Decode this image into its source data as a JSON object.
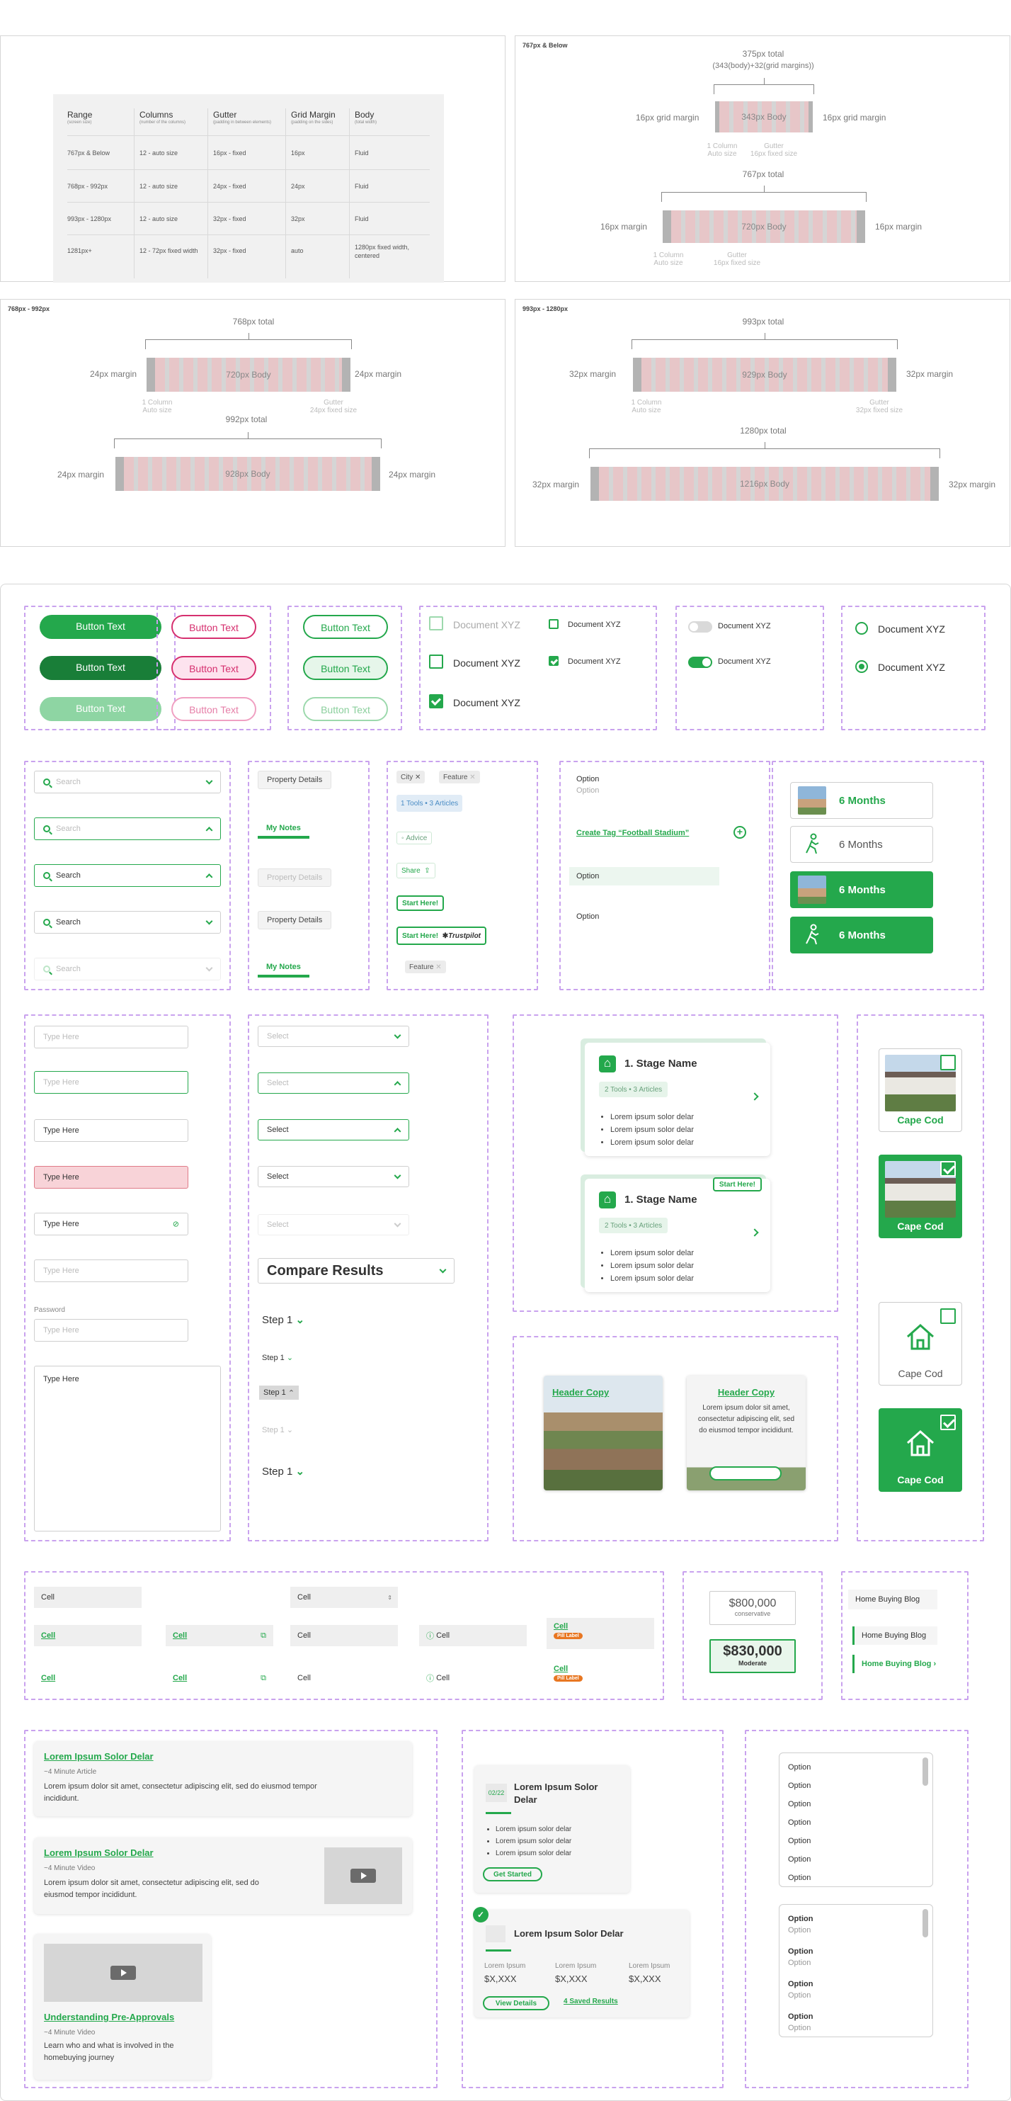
{
  "grid_table": {
    "headers": [
      {
        "title": "Range",
        "sub": "(screen size)"
      },
      {
        "title": "Columns",
        "sub": "(number of the columns)"
      },
      {
        "title": "Gutter",
        "sub": "(padding in between elements)"
      },
      {
        "title": "Grid Margin",
        "sub": "(padding on the sides)"
      },
      {
        "title": "Body",
        "sub": "(total width)"
      }
    ],
    "rows": [
      [
        "767px & Below",
        "12 - auto size",
        "16px - fixed",
        "16px",
        "Fluid"
      ],
      [
        "768px - 992px",
        "12 - auto size",
        "24px - fixed",
        "24px",
        "Fluid"
      ],
      [
        "993px - 1280px",
        "12 - auto size",
        "32px - fixed",
        "32px",
        "Fluid"
      ],
      [
        "1281px+",
        "12 - 72px fixed width",
        "32px - fixed",
        "auto",
        "1280px fixed width, centered"
      ]
    ]
  },
  "small_frame": {
    "title": "767px & Below",
    "top_total": "375px total",
    "top_formula": "(343(body)+32(grid margins))",
    "margin": "16px grid margin",
    "body": "343px Body",
    "col_note": "1 Column\nAuto size",
    "gutter_note": "Gutter\n16px fixed size",
    "bottom_total": "767px total",
    "bottom_margin": "16px margin",
    "bottom_body": "720px Body",
    "bottom_col_note": "1 Column\nAuto size",
    "bottom_gutter_note": "Gutter\n16px fixed size"
  },
  "mid_frame": {
    "title": "768px - 992px",
    "top_total": "768px total",
    "margin": "24px margin",
    "body": "720px Body",
    "col_note": "1 Column\nAuto size",
    "gutter_note": "Gutter\n24px fixed size",
    "bottom_total": "992px total",
    "bottom_body": "928px Body"
  },
  "large_frame": {
    "title": "993px - 1280px",
    "top_total": "993px total",
    "margin": "32px margin",
    "body": "929px Body",
    "col_note": "1 Column\nAuto size",
    "gutter_note": "Gutter\n32px fixed size",
    "bottom_total": "1280px total",
    "bottom_body": "1216px Body"
  },
  "buttons": {
    "label": "Button Text"
  },
  "checkboxes": {
    "label": "Document XYZ"
  },
  "toggles": {
    "label": "Document XYZ"
  },
  "radios": {
    "label": "Document XYZ"
  },
  "search": {
    "placeholder": "Search",
    "value": "Search"
  },
  "tabs": {
    "property": "Property Details",
    "notes": "My Notes"
  },
  "chips": {
    "city": "City",
    "feature": "Feature",
    "tools": "1 Tools  •  3 Articles",
    "advice": "Advice",
    "share": "Share",
    "start": "Start Here!",
    "trustpilot": "Trustpilot"
  },
  "options_menu": {
    "option": "Option",
    "create": "Create Tag “Football Stadium”"
  },
  "months": {
    "label": "6 Months"
  },
  "text_inputs": {
    "placeholder": "Type Here",
    "value": "Type Here",
    "password_label": "Password"
  },
  "selects": {
    "placeholder": "Select",
    "value": "Select",
    "compare": "Compare Results",
    "step": "Step 1"
  },
  "stage_cards": {
    "title": "1. Stage Name",
    "tag": "2 Tools  •  3 Articles",
    "bullets": [
      "Lorem ipsum solor delar",
      "Lorem ipsum solor delar",
      "Lorem ipsum solor delar"
    ],
    "badge": "Start Here!"
  },
  "header_cards": {
    "title": "Header Copy",
    "body": "Lorem ipsum dolor sit amet, consectetur adipiscing elit, sed do eiusmod tempor incididunt."
  },
  "house_cards": {
    "label": "Cape Cod"
  },
  "cells": {
    "cell": "Cell",
    "pill": "Pill Label"
  },
  "price_cards": {
    "a_price": "$800,000",
    "a_label": "conservative",
    "b_price": "$830,000",
    "b_label": "Moderate"
  },
  "blog_links": {
    "label": "Home Buying Blog"
  },
  "articles": {
    "title1": "Lorem Ipsum Solor Delar",
    "meta1": "~4 Minute Article",
    "body": "Lorem ipsum dolor sit amet, consectetur adipiscing elit, sed do eiusmod tempor incididunt.",
    "title2": "Lorem Ipsum Solor Delar",
    "meta2": "~4 Minute Video",
    "title3": "Understanding Pre-Approvals",
    "meta3": "~4 Minute Video",
    "body3": "Learn who and what is involved in the homebuying journey"
  },
  "lorem_cards": {
    "date": "02/22",
    "title": "Lorem Ipsum Solor Delar",
    "bullets": [
      "Lorem ipsum solor delar",
      "Lorem ipsum solor delar",
      "Lorem ipsum solor delar"
    ],
    "cta": "Get Started",
    "stat_label": "Lorem Ipsum",
    "stat_value": "$X,XXX",
    "view": "View Details",
    "saved": "4 Saved Results"
  },
  "option_lists": {
    "option": "Option"
  }
}
